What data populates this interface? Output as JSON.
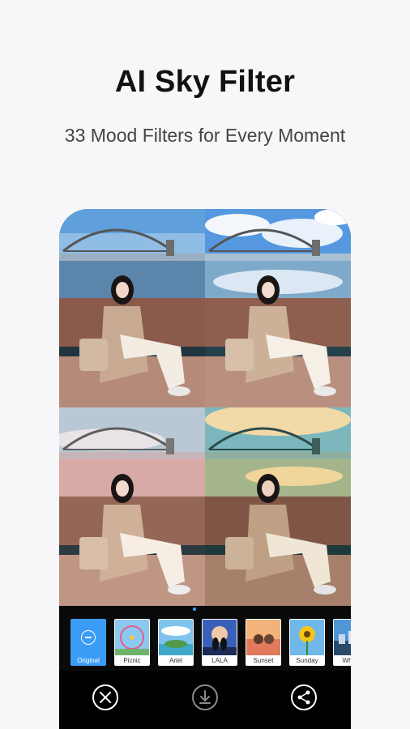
{
  "header": {
    "title": "AI Sky Filter",
    "subtitle": "33 Mood Filters for Every Moment"
  },
  "preview": {
    "panels": [
      {
        "id": "original",
        "sky": "#7fb2e0",
        "water": "#5a84a8"
      },
      {
        "id": "cloudy-blue",
        "sky": "#5a9de0",
        "water": "#7aa6c6"
      },
      {
        "id": "pastel-pink",
        "sky": "#b7c7d6",
        "water": "#d7a8a4"
      },
      {
        "id": "sunset-teal",
        "sky": "#8fc1c0",
        "water": "#a9b98e"
      }
    ]
  },
  "filters": {
    "selected": "Original",
    "items": [
      {
        "label": "Original",
        "icon": "minus-circle-icon"
      },
      {
        "label": "Picnic",
        "icon": "ferris-wheel-icon"
      },
      {
        "label": "Ariel",
        "icon": "island-icon"
      },
      {
        "label": "LALA",
        "icon": "couple-silhouette-icon"
      },
      {
        "label": "Sunset",
        "icon": "sunset-people-icon"
      },
      {
        "label": "Sunday",
        "icon": "sunflower-icon"
      },
      {
        "label": "When",
        "icon": "city-icon"
      }
    ]
  },
  "actions": {
    "close": "close-icon",
    "download": "download-icon",
    "share": "share-icon"
  },
  "colors": {
    "accent": "#3b9cf5",
    "background": "#f7f7f9",
    "toolbar": "#000000"
  }
}
